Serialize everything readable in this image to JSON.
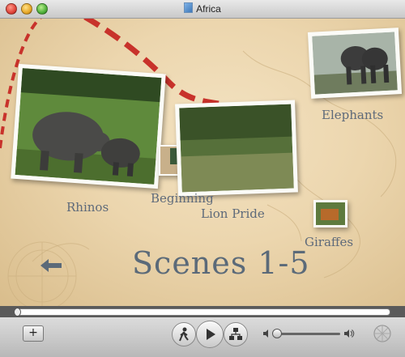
{
  "window": {
    "title": "Africa"
  },
  "scenes": [
    {
      "label": "Rhinos"
    },
    {
      "label": "Beginning"
    },
    {
      "label": "Lion Pride"
    },
    {
      "label": "Elephants"
    },
    {
      "label": "Giraffes"
    }
  ],
  "menu_title": "Scenes 1-5",
  "controls": {
    "add_label": "+",
    "icons": [
      "chapter-walk-icon",
      "play-icon",
      "chapters-menu-icon",
      "volume-low-icon",
      "volume-high-icon",
      "loading-spinner-icon"
    ]
  },
  "playback": {
    "position": 0,
    "volume": 0.1
  }
}
